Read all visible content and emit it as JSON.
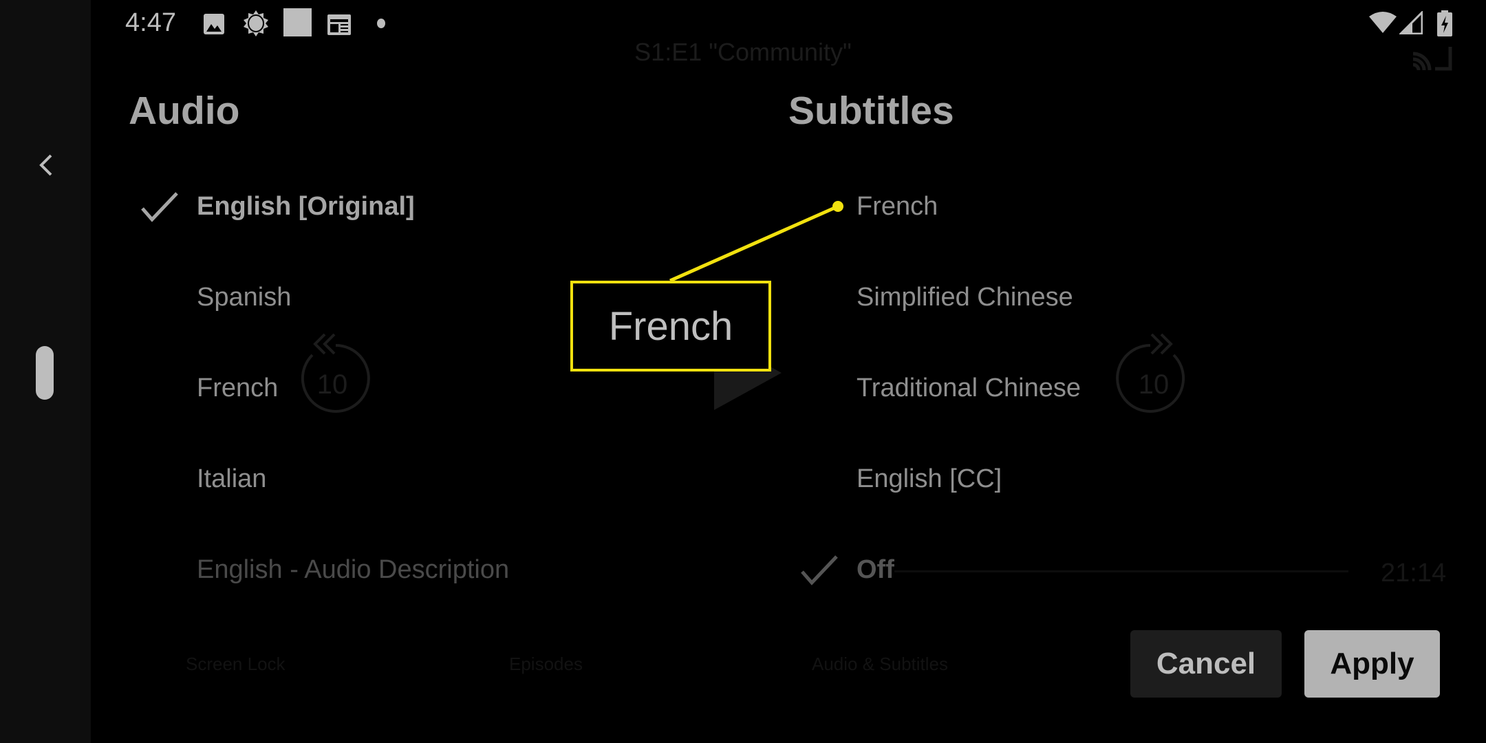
{
  "status_bar": {
    "time": "4:47",
    "left_icons": [
      "image-icon",
      "brightness-icon",
      "square-icon",
      "news-icon",
      "dot-icon"
    ],
    "right_icons": [
      "wifi-icon",
      "signal-icon",
      "battery-charging-icon"
    ]
  },
  "player_background": {
    "episode_title": "S1:E1 \"Community\"",
    "rewind_label": "10",
    "forward_label": "10",
    "duration": "21:14",
    "bottom_controls": [
      "Screen Lock",
      "Episodes",
      "Audio & Subtitles"
    ]
  },
  "audio": {
    "title": "Audio",
    "options": [
      {
        "label": "English [Original]",
        "selected": true
      },
      {
        "label": "Spanish",
        "selected": false
      },
      {
        "label": "French",
        "selected": false
      },
      {
        "label": "Italian",
        "selected": false
      },
      {
        "label": "English - Audio Description",
        "selected": false
      }
    ]
  },
  "subtitles": {
    "title": "Subtitles",
    "options": [
      {
        "label": "French",
        "selected": false
      },
      {
        "label": "Simplified Chinese",
        "selected": false
      },
      {
        "label": "Traditional Chinese",
        "selected": false
      },
      {
        "label": "English [CC]",
        "selected": false
      },
      {
        "label": "Off",
        "selected": true
      }
    ]
  },
  "callout": {
    "label": "French",
    "color": "#f2e10f"
  },
  "actions": {
    "cancel_label": "Cancel",
    "apply_label": "Apply"
  }
}
